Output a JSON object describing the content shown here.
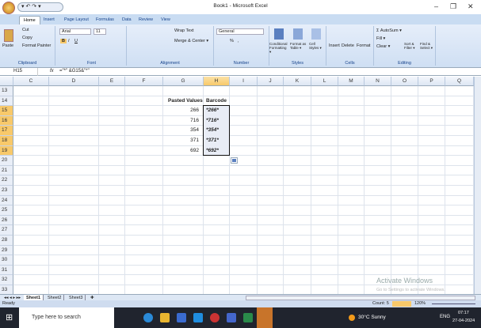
{
  "window": {
    "title": "Book1 - Microsoft Excel",
    "minimize": "–",
    "restore": "❐",
    "close": "✕"
  },
  "qat": "▾ ↶ ↷ ▾",
  "tabs": [
    "Home",
    "Insert",
    "Page Layout",
    "Formulas",
    "Data",
    "Review",
    "View"
  ],
  "ribbon": {
    "clipboard": {
      "label": "Clipboard",
      "paste": "Paste",
      "cut": "Cut",
      "copy": "Copy",
      "format_painter": "Format Painter"
    },
    "font": {
      "label": "Font",
      "name": "Arial",
      "size": "11",
      "bold": "B",
      "italic": "I",
      "underline": "U"
    },
    "alignment": {
      "label": "Alignment",
      "wrap": "Wrap Text",
      "merge": "Merge & Center ▾"
    },
    "number": {
      "label": "Number",
      "format": "General",
      "percent": "%",
      "comma": ","
    },
    "styles": {
      "label": "Styles",
      "conditional": "Conditional Formatting ▾",
      "format_table": "Format as Table ▾",
      "cell_styles": "Cell Styles ▾"
    },
    "cells": {
      "label": "Cells",
      "insert": "Insert",
      "delete": "Delete",
      "format": "Format"
    },
    "editing": {
      "label": "Editing",
      "autosum": "Σ AutoSum ▾",
      "fill": "Fill ▾",
      "clear": "Clear ▾",
      "sort": "Sort & Filter ▾",
      "find": "Find & Select ▾"
    }
  },
  "formula_bar": {
    "name_box": "H15",
    "fx": "fx",
    "formula": "=\"*\" &G15&\"*\""
  },
  "columns": [
    "C",
    "D",
    "E",
    "F",
    "G",
    "H",
    "I",
    "J",
    "K",
    "L",
    "M",
    "N",
    "O",
    "P",
    "Q"
  ],
  "rows": [
    "13",
    "14",
    "15",
    "16",
    "17",
    "18",
    "19",
    "20",
    "21",
    "22",
    "23",
    "24",
    "25",
    "26",
    "27",
    "28",
    "29",
    "30",
    "31",
    "32",
    "33"
  ],
  "table": {
    "header_g": "Pasted Values",
    "header_h": "Barcode",
    "values": [
      "266",
      "716",
      "354",
      "371",
      "692"
    ],
    "barcodes": [
      "*266*",
      "*716*",
      "*354*",
      "*371*",
      "*692*"
    ]
  },
  "sheets": [
    "Sheet1",
    "Sheet2",
    "Sheet3"
  ],
  "status": {
    "ready": "Ready",
    "count": "Count: 5",
    "zoom": "120%"
  },
  "watermark": {
    "line1": "Activate Windows",
    "line2": "Go to Settings to activate Windows."
  },
  "taskbar": {
    "search": "Type here to search",
    "weather": "30°C  Sunny",
    "lang": "ENG",
    "time": "07:17",
    "date": "27-04-2024"
  }
}
